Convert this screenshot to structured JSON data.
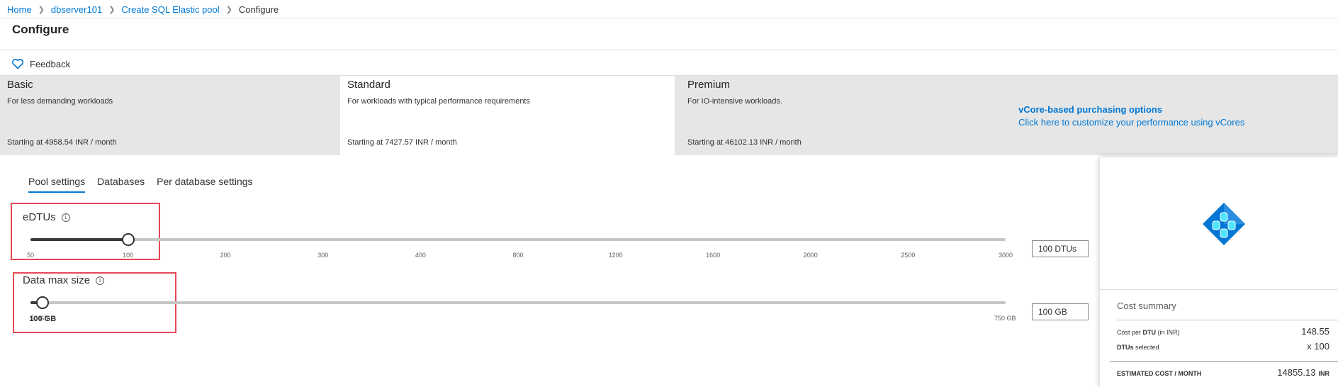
{
  "breadcrumb": {
    "home": "Home",
    "server": "dbserver101",
    "pool": "Create SQL Elastic pool",
    "current": "Configure"
  },
  "page": {
    "title": "Configure"
  },
  "toolbar": {
    "feedback_label": "Feedback"
  },
  "tiers": [
    {
      "name": "Basic",
      "desc": "For less demanding workloads",
      "price": "Starting at 4958.54 INR / month",
      "selected": false
    },
    {
      "name": "Standard",
      "desc": "For workloads with typical performance requirements",
      "price": "Starting at 7427.57 INR / month",
      "selected": true
    },
    {
      "name": "Premium",
      "desc": "For IO-intensive workloads.",
      "price": "Starting at 46102.13 INR / month",
      "selected": false
    }
  ],
  "vcore": {
    "title": "vCore-based purchasing options",
    "link": "Click here to customize your performance using vCores"
  },
  "tabs": [
    {
      "label": "Pool settings",
      "active": true
    },
    {
      "label": "Databases",
      "active": false
    },
    {
      "label": "Per database settings",
      "active": false
    }
  ],
  "edtu": {
    "label": "eDTUs",
    "ticks": [
      "50",
      "100",
      "200",
      "300",
      "400",
      "800",
      "1200",
      "1600",
      "2000",
      "2500",
      "3000"
    ],
    "selected_tick_index": 1,
    "value": "100 DTUs"
  },
  "data_size": {
    "label": "Data max size",
    "min_tick": "50 GB",
    "selected_tick": "100 GB",
    "max_tick": "750 GB",
    "selected_fraction": 0.0125,
    "value": "100 GB"
  },
  "cost_summary": {
    "title": "Cost summary",
    "cost_per_dtu_label": "Cost per",
    "cost_per_dtu_bold": "DTU",
    "cost_per_dtu_suffix": "(in INR)",
    "cost_per_dtu_value": "148.55",
    "dtus_selected_label": "DTUs",
    "dtus_selected_suffix": "selected",
    "dtus_selected_value": "x 100",
    "estimated_label": "ESTIMATED COST / MONTH",
    "estimated_value": "14855.13",
    "estimated_unit": "INR"
  },
  "colors": {
    "accent": "#0078d4",
    "highlight": "#e74856",
    "tier_bg": "#e6e6e6"
  },
  "icons": [
    "chevron-right-icon",
    "heart-icon",
    "info-icon",
    "elastic-pool-icon"
  ]
}
